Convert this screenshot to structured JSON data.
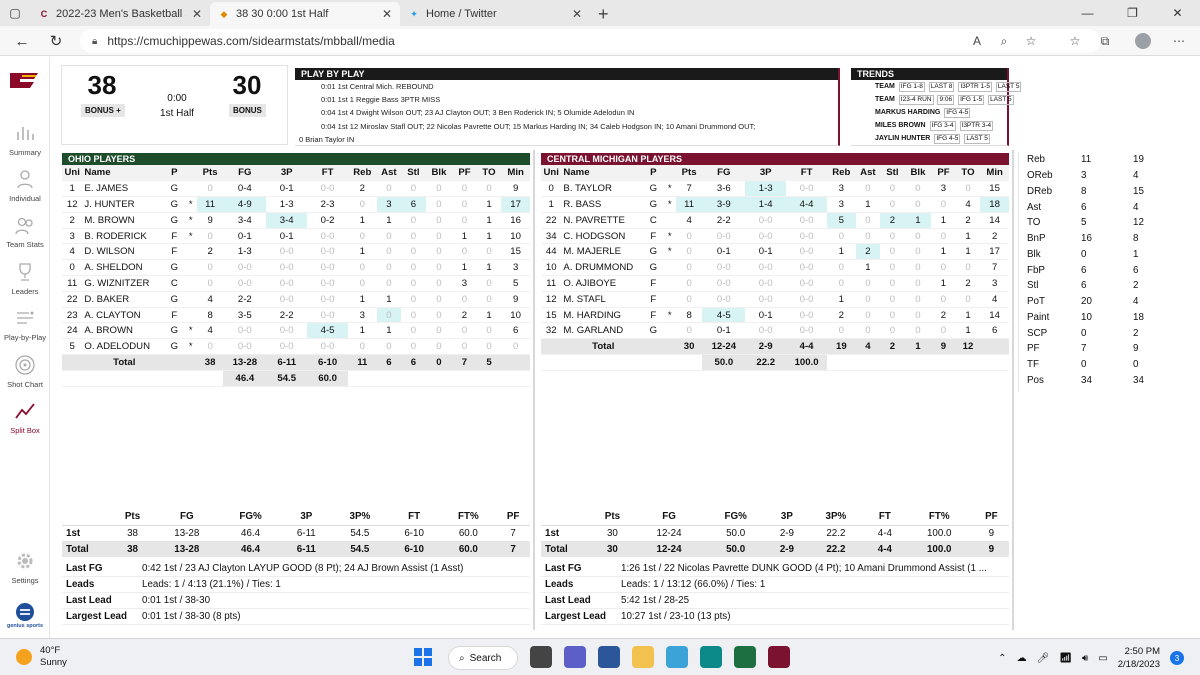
{
  "browser": {
    "tabs": [
      {
        "title": "2022-23 Men's Basketball Schedu",
        "active": false
      },
      {
        "title": "38 30 0:00 1st Half",
        "active": true
      },
      {
        "title": "Home / Twitter",
        "active": false
      }
    ],
    "url": "https://cmuchippewas.com/sidearmstats/mbball/media"
  },
  "sidebar": {
    "items": [
      {
        "label": "Summary",
        "icon": "bar-chart-icon"
      },
      {
        "label": "Individual",
        "icon": "person-icon"
      },
      {
        "label": "Team Stats",
        "icon": "people-icon"
      },
      {
        "label": "Leaders",
        "icon": "trophy-icon"
      },
      {
        "label": "Play-by-Play",
        "icon": "play-list-icon"
      },
      {
        "label": "Shot Chart",
        "icon": "target-icon"
      },
      {
        "label": "Split Box",
        "icon": "trend-icon"
      }
    ],
    "settings": "Settings",
    "footer_logo": "genius sports"
  },
  "score": {
    "home": "38",
    "away": "30",
    "home_bonus": "BONUS +",
    "away_bonus": "BONUS",
    "clock": "0:00",
    "period": "1st Half"
  },
  "pbp": {
    "title": "PLAY BY PLAY",
    "lines": [
      "0:01 1st Central Mich. REBOUND",
      "0:01 1st 1 Reggie Bass 3PTR MISS",
      "0:04 1st 4 Dwight Wilson OUT; 23 AJ Clayton OUT; 3 Ben Roderick IN; 5 Olumide Adelodun IN",
      "0:04 1st 12 Miroslav Stafl OUT; 22 Nicolas Pavrette OUT; 15 Markus Harding IN; 34 Caleb Hodgson IN; 10 Amani Drummond OUT;",
      "0 Brian Taylor IN"
    ]
  },
  "trends": {
    "title": "TRENDS",
    "rows": [
      {
        "name": "TEAM",
        "chips": [
          "IFG 1-8",
          "LAST 8",
          "I3PTR 1-5",
          "LAST 5"
        ]
      },
      {
        "name": "TEAM",
        "chips": [
          "I23-4 RUN",
          "9:06",
          "IFG 1-5",
          "LAST 5"
        ]
      },
      {
        "name": "MARKUS HARDING",
        "chips": [
          "IFG 4-5"
        ]
      },
      {
        "name": "MILES BROWN",
        "chips": [
          "IFG 3-4",
          "I3PTR 3-4"
        ]
      },
      {
        "name": "JAYLIN HUNTER",
        "chips": [
          "IFG 4-5",
          "LAST 5"
        ]
      }
    ]
  },
  "columns": [
    "Uni",
    "Name",
    "P",
    "",
    "Pts",
    "FG",
    "3P",
    "FT",
    "Reb",
    "Ast",
    "Stl",
    "Blk",
    "PF",
    "TO",
    "Min"
  ],
  "ohio": {
    "title": "OHIO PLAYERS",
    "players": [
      [
        "1",
        "E. JAMES",
        "G",
        "",
        "0",
        "0-4",
        "0-1",
        "0-0",
        "2",
        "0",
        "0",
        "0",
        "0",
        "0",
        "9"
      ],
      [
        "12",
        "J. HUNTER",
        "G",
        "*",
        "11",
        "4-9",
        "1-3",
        "2-3",
        "0",
        "3",
        "6",
        "0",
        "0",
        "1",
        "17"
      ],
      [
        "2",
        "M. BROWN",
        "G",
        "*",
        "9",
        "3-4",
        "3-4",
        "0-2",
        "1",
        "1",
        "0",
        "0",
        "0",
        "1",
        "16"
      ],
      [
        "3",
        "B. RODERICK",
        "F",
        "*",
        "0",
        "0-1",
        "0-1",
        "0-0",
        "0",
        "0",
        "0",
        "0",
        "1",
        "1",
        "10"
      ],
      [
        "4",
        "D. WILSON",
        "F",
        "",
        "2",
        "1-3",
        "0-0",
        "0-0",
        "1",
        "0",
        "0",
        "0",
        "0",
        "0",
        "15"
      ],
      [
        "0",
        "A. SHELDON",
        "G",
        "",
        "0",
        "0-0",
        "0-0",
        "0-0",
        "0",
        "0",
        "0",
        "0",
        "1",
        "1",
        "3"
      ],
      [
        "11",
        "G. WIZNITZER",
        "C",
        "",
        "0",
        "0-0",
        "0-0",
        "0-0",
        "0",
        "0",
        "0",
        "0",
        "3",
        "0",
        "5"
      ],
      [
        "22",
        "D. BAKER",
        "G",
        "",
        "4",
        "2-2",
        "0-0",
        "0-0",
        "1",
        "1",
        "0",
        "0",
        "0",
        "0",
        "9"
      ],
      [
        "23",
        "A. CLAYTON",
        "F",
        "",
        "8",
        "3-5",
        "2-2",
        "0-0",
        "3",
        "0",
        "0",
        "0",
        "2",
        "1",
        "10"
      ],
      [
        "24",
        "A. BROWN",
        "G",
        "*",
        "4",
        "0-0",
        "0-0",
        "4-5",
        "1",
        "1",
        "0",
        "0",
        "0",
        "0",
        "6"
      ],
      [
        "5",
        "O. ADELODUN",
        "G",
        "*",
        "0",
        "0-0",
        "0-0",
        "0-0",
        "0",
        "0",
        "0",
        "0",
        "0",
        "0",
        "0"
      ]
    ],
    "total": {
      "label": "Total",
      "vals": [
        "38",
        "13-28",
        "6-11",
        "6-10",
        "11",
        "6",
        "6",
        "0",
        "7",
        "5",
        ""
      ]
    },
    "pct": [
      "46.4",
      "54.5",
      "60.0"
    ]
  },
  "cmu": {
    "title": "CENTRAL MICHIGAN PLAYERS",
    "players": [
      [
        "0",
        "B. TAYLOR",
        "G",
        "*",
        "7",
        "3-6",
        "1-3",
        "0-0",
        "3",
        "0",
        "0",
        "0",
        "3",
        "0",
        "15"
      ],
      [
        "1",
        "R. BASS",
        "G",
        "*",
        "11",
        "3-9",
        "1-4",
        "4-4",
        "3",
        "1",
        "0",
        "0",
        "0",
        "4",
        "18"
      ],
      [
        "22",
        "N. PAVRETTE",
        "C",
        "",
        "4",
        "2-2",
        "0-0",
        "0-0",
        "5",
        "0",
        "2",
        "1",
        "1",
        "2",
        "14"
      ],
      [
        "34",
        "C. HODGSON",
        "F",
        "*",
        "0",
        "0-0",
        "0-0",
        "0-0",
        "0",
        "0",
        "0",
        "0",
        "0",
        "1",
        "2"
      ],
      [
        "44",
        "M. MAJERLE",
        "G",
        "*",
        "0",
        "0-1",
        "0-1",
        "0-0",
        "1",
        "2",
        "0",
        "0",
        "1",
        "1",
        "17"
      ],
      [
        "10",
        "A. DRUMMOND",
        "G",
        "",
        "0",
        "0-0",
        "0-0",
        "0-0",
        "0",
        "1",
        "0",
        "0",
        "0",
        "0",
        "7"
      ],
      [
        "11",
        "O. AJIBOYE",
        "F",
        "",
        "0",
        "0-0",
        "0-0",
        "0-0",
        "0",
        "0",
        "0",
        "0",
        "1",
        "2",
        "3"
      ],
      [
        "12",
        "M. STAFL",
        "F",
        "",
        "0",
        "0-0",
        "0-0",
        "0-0",
        "1",
        "0",
        "0",
        "0",
        "0",
        "0",
        "4"
      ],
      [
        "15",
        "M. HARDING",
        "F",
        "*",
        "8",
        "4-5",
        "0-1",
        "0-0",
        "2",
        "0",
        "0",
        "0",
        "2",
        "1",
        "14"
      ],
      [
        "32",
        "M. GARLAND",
        "G",
        "",
        "0",
        "0-1",
        "0-0",
        "0-0",
        "0",
        "0",
        "0",
        "0",
        "0",
        "1",
        "6"
      ]
    ],
    "total": {
      "label": "Total",
      "vals": [
        "30",
        "12-24",
        "2-9",
        "4-4",
        "19",
        "4",
        "2",
        "1",
        "9",
        "12",
        ""
      ]
    },
    "pct": [
      "50.0",
      "22.2",
      "100.0"
    ]
  },
  "compare": [
    [
      "Reb",
      "11",
      "19"
    ],
    [
      "OReb",
      "3",
      "4"
    ],
    [
      "DReb",
      "8",
      "15"
    ],
    [
      "Ast",
      "6",
      "4"
    ],
    [
      "TO",
      "5",
      "12"
    ],
    [
      "BnP",
      "16",
      "8"
    ],
    [
      "Blk",
      "0",
      "1"
    ],
    [
      "FbP",
      "6",
      "6"
    ],
    [
      "Stl",
      "6",
      "2"
    ],
    [
      "PoT",
      "20",
      "4"
    ],
    [
      "Paint",
      "10",
      "18"
    ],
    [
      "SCP",
      "0",
      "2"
    ],
    [
      "PF",
      "7",
      "9"
    ],
    [
      "TF",
      "0",
      "0"
    ],
    [
      "Pos",
      "34",
      "34"
    ]
  ],
  "summary_cols": [
    "",
    "Pts",
    "FG",
    "FG%",
    "3P",
    "3P%",
    "FT",
    "FT%",
    "PF"
  ],
  "ohio_summary": [
    [
      "1st",
      "38",
      "13-28",
      "46.4",
      "6-11",
      "54.5",
      "6-10",
      "60.0",
      "7"
    ],
    [
      "Total",
      "38",
      "13-28",
      "46.4",
      "6-11",
      "54.5",
      "6-10",
      "60.0",
      "7"
    ]
  ],
  "cmu_summary": [
    [
      "1st",
      "30",
      "12-24",
      "50.0",
      "2-9",
      "22.2",
      "4-4",
      "100.0",
      "9"
    ],
    [
      "Total",
      "30",
      "12-24",
      "50.0",
      "2-9",
      "22.2",
      "4-4",
      "100.0",
      "9"
    ]
  ],
  "ohio_info": [
    [
      "Last FG",
      "0:42 1st / 23 AJ Clayton LAYUP GOOD (8 Pt); 24 AJ Brown Assist (1 Asst)"
    ],
    [
      "Leads",
      "Leads: 1 / 4:13 (21.1%) / Ties: 1"
    ],
    [
      "Last Lead",
      "0:01 1st / 38-30"
    ],
    [
      "Largest Lead",
      "0:01 1st / 38-30 (8 pts)"
    ]
  ],
  "cmu_info": [
    [
      "Last FG",
      "1:26 1st / 22 Nicolas Pavrette DUNK GOOD (4 Pt); 10 Amani Drummond Assist (1 ..."
    ],
    [
      "Leads",
      "Leads: 1 / 13:12 (66.0%) / Ties: 1"
    ],
    [
      "Last Lead",
      "5:42 1st / 28-25"
    ],
    [
      "Largest Lead",
      "10:27 1st / 23-10 (13 pts)"
    ]
  ],
  "highlights": {
    "ohio": [
      [
        1,
        4
      ],
      [
        1,
        5
      ],
      [
        1,
        9
      ],
      [
        1,
        10
      ],
      [
        1,
        14
      ],
      [
        2,
        6
      ],
      [
        8,
        9
      ],
      [
        9,
        7
      ]
    ],
    "cmu": [
      [
        0,
        6
      ],
      [
        1,
        4
      ],
      [
        1,
        5
      ],
      [
        1,
        6
      ],
      [
        1,
        7
      ],
      [
        1,
        14
      ],
      [
        2,
        8
      ],
      [
        2,
        10
      ],
      [
        2,
        11
      ],
      [
        4,
        9
      ],
      [
        8,
        5
      ]
    ]
  },
  "taskbar": {
    "temp": "40°F",
    "weather": "Sunny",
    "search": "Search",
    "time": "2:50 PM",
    "date": "2/18/2023",
    "notif_count": "3"
  },
  "colors": {
    "ohio": "#1e4d2b",
    "cmu": "#7a1230",
    "highlight": "#d7f3f3",
    "gold": "#f0b400"
  }
}
